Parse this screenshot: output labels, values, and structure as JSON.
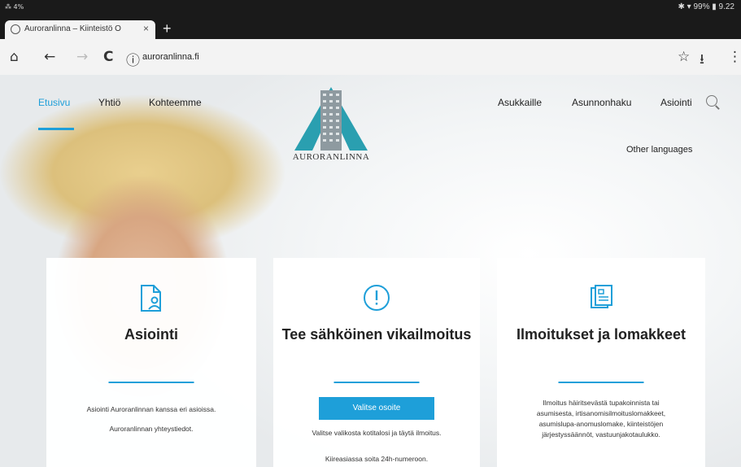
{
  "statusbar": {
    "left": "⁂ 4%",
    "right": "✱ ▾ 99% ▮ 9.22"
  },
  "browser": {
    "tab_title": "Auroranlinna – Kiinteistö O",
    "tab_close": "×",
    "new_tab": "+",
    "url": "auroranlinna.fi",
    "icons": {
      "home": "⌂",
      "back": "←",
      "forward": "→",
      "reload": "C",
      "info": "ⓘ",
      "star": "☆",
      "download": "⭳",
      "menu": "⋮"
    }
  },
  "nav": {
    "left": [
      "Etusivu",
      "Yhtiö",
      "Kohteemme"
    ],
    "right": [
      "Asukkaille",
      "Asunnonhaku",
      "Asiointi"
    ],
    "logo_text": "AURORANLINNA",
    "other_languages": "Other languages"
  },
  "cards": [
    {
      "title": "Asiointi",
      "lines": [
        "Asiointi Auroranlinnan kanssa eri asioissa.",
        "Auroranlinnan yhteystiedot."
      ],
      "icon": "document-person-icon"
    },
    {
      "title": "Tee sähköinen vikailmoitus",
      "button": "Valitse osoite",
      "lines": [
        "Valitse valikosta kotitalosi ja täytä ilmoitus.",
        "Kiireasiassa soita 24h-numeroon."
      ],
      "icon": "exclamation-circle-icon"
    },
    {
      "title": "Ilmoitukset ja lomakkeet",
      "lines": [
        "Ilmoitus häiritsevästä tupakoinnista tai",
        "asumisesta, irtisanomisilmoituslomakkeet,",
        "asumislupa-anomuslomake, kiinteistöjen",
        "järjestyssäännöt, vastuunjakotaulukko."
      ],
      "icon": "forms-icon"
    }
  ],
  "colors": {
    "accent": "#1e9fd9",
    "logo_teal": "#2a9fb0"
  }
}
